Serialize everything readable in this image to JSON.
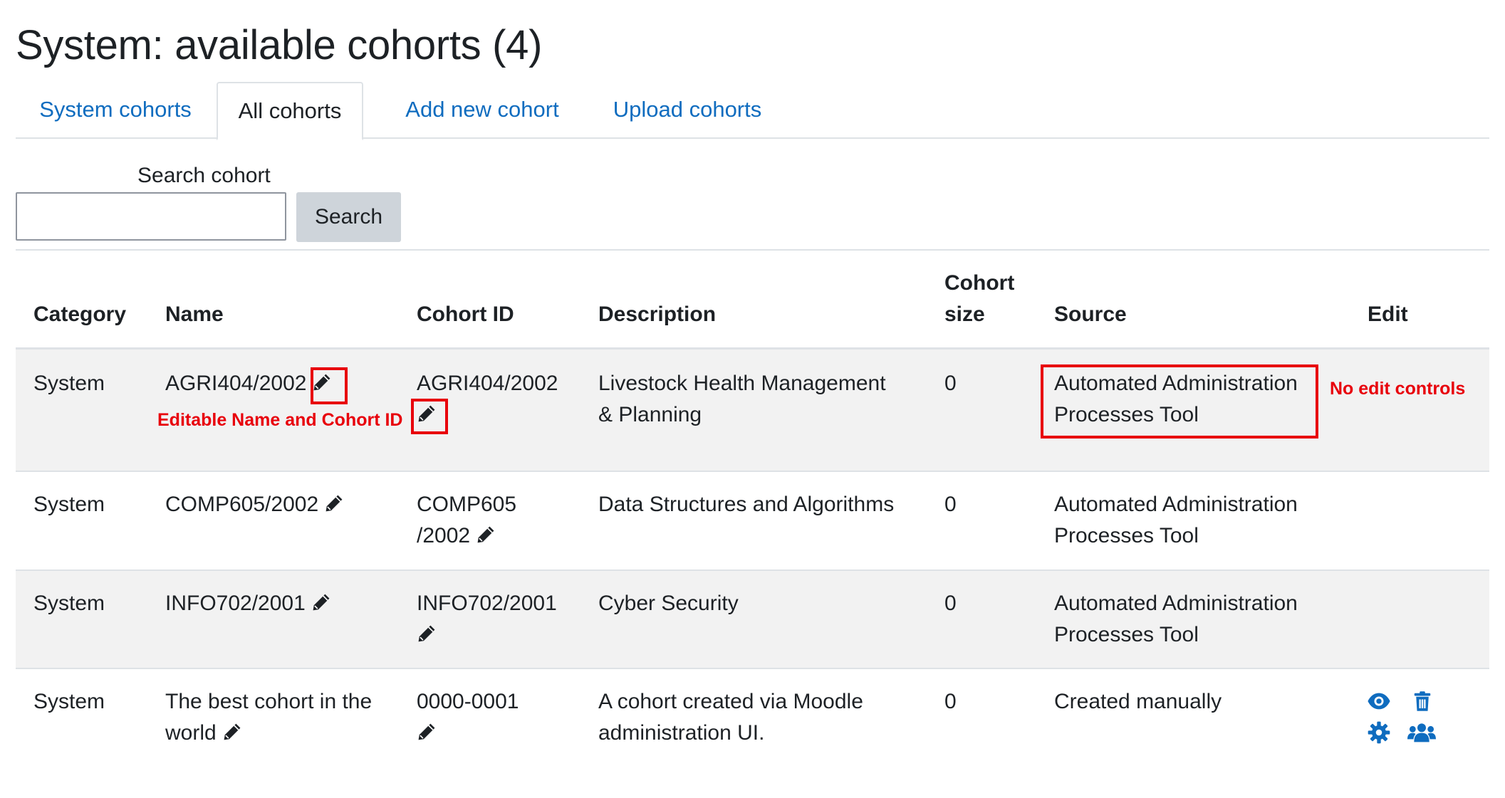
{
  "page": {
    "title": "System: available cohorts (4)"
  },
  "tabs": [
    {
      "label": "System cohorts"
    },
    {
      "label": "All cohorts"
    },
    {
      "label": "Add new cohort"
    },
    {
      "label": "Upload cohorts"
    }
  ],
  "search": {
    "label": "Search cohort",
    "value": "",
    "button_label": "Search"
  },
  "table": {
    "headers": {
      "category": "Category",
      "name": "Name",
      "cohort_id": "Cohort ID",
      "description": "Description",
      "size_line1": "Cohort",
      "size_line2": "size",
      "source": "Source",
      "edit": "Edit"
    },
    "rows": [
      {
        "category": "System",
        "name": "AGRI404/2002",
        "cohort_id": "AGRI404/2002",
        "description_l1": "Livestock Health Management",
        "description_l2": "& Planning",
        "size": "0",
        "source_l1": "Automated Administration",
        "source_l2": "Processes Tool"
      },
      {
        "category": "System",
        "name": "COMP605/2002",
        "cohort_id_l1": "COMP605",
        "cohort_id_l2": "/2002",
        "description": "Data Structures and Algorithms",
        "size": "0",
        "source_l1": "Automated Administration",
        "source_l2": "Processes Tool"
      },
      {
        "category": "System",
        "name": "INFO702/2001",
        "cohort_id": "INFO702/2001",
        "description": "Cyber Security",
        "size": "0",
        "source_l1": "Automated Administration",
        "source_l2": "Processes Tool"
      },
      {
        "category": "System",
        "name_l1": "The best cohort in the",
        "name_l2": "world",
        "cohort_id": "0000-0001",
        "description_l1": "A cohort created via Moodle",
        "description_l2": "administration UI.",
        "size": "0",
        "source": "Created manually"
      }
    ]
  },
  "annotations": {
    "editable_note": "Editable Name and Cohort ID",
    "no_edit_note": "No edit controls"
  },
  "colors": {
    "link": "#0f6cbf",
    "annotation": "#e8000b",
    "stripe": "#f2f2f2"
  },
  "icons": {
    "edit": "pencil-icon",
    "view": "eye-icon",
    "delete": "trash-icon",
    "settings": "gear-icon",
    "members": "users-icon"
  }
}
